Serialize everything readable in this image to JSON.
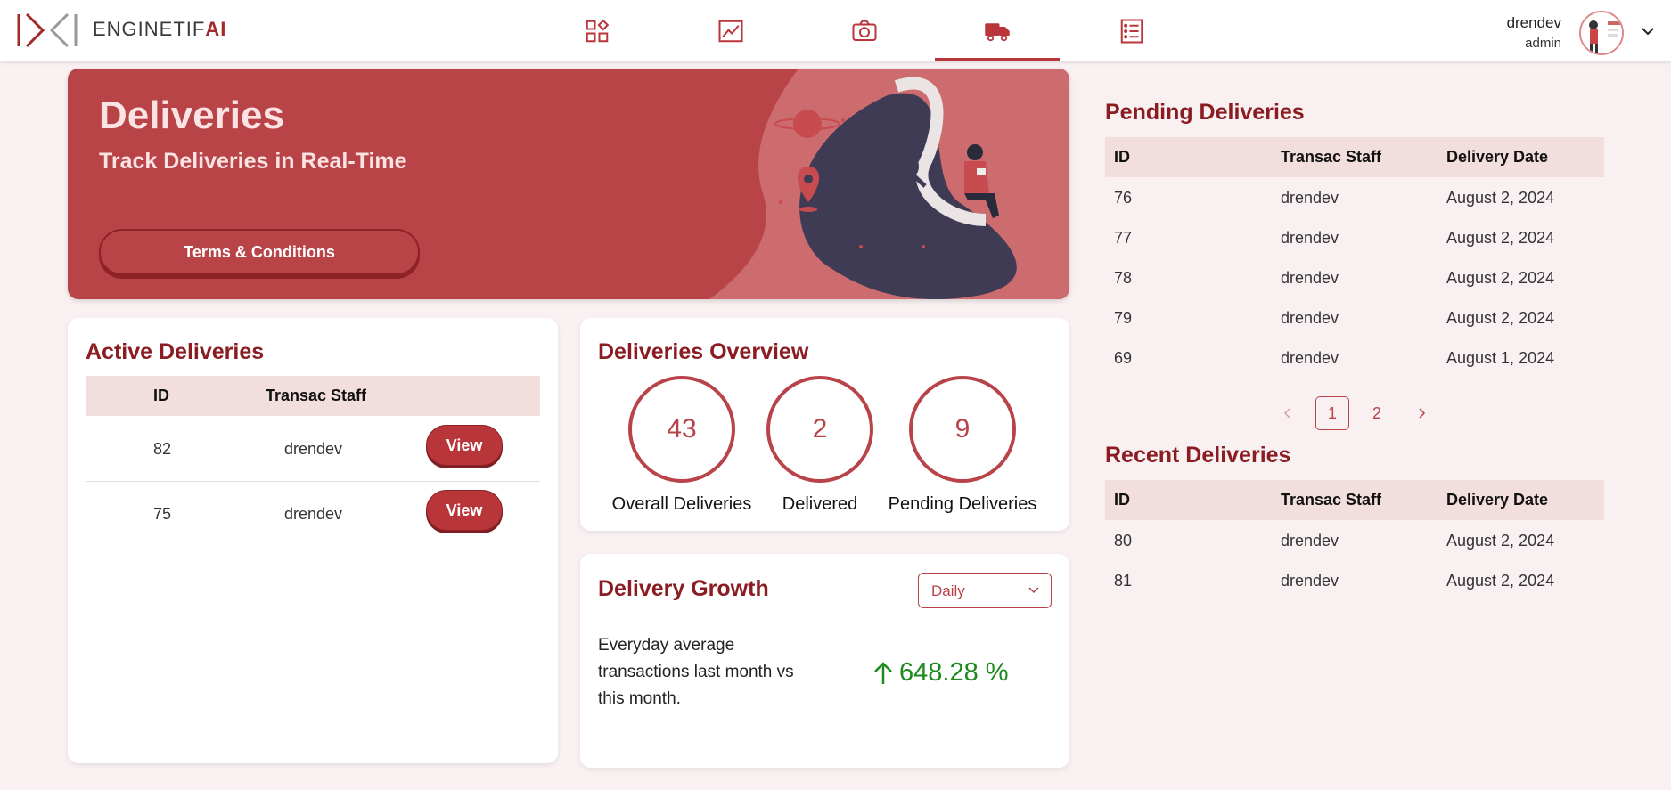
{
  "brand": {
    "name_prefix": "ENGINETIF",
    "name_suffix": "AI"
  },
  "nav": [
    {
      "icon": "dashboard-grid-icon"
    },
    {
      "icon": "chart-line-icon"
    },
    {
      "icon": "camera-icon"
    },
    {
      "icon": "truck-icon",
      "active": true
    },
    {
      "icon": "list-document-icon"
    }
  ],
  "user": {
    "name": "drendev",
    "role": "admin"
  },
  "hero": {
    "title": "Deliveries",
    "subtitle": "Track Deliveries in Real-Time",
    "terms_label": "Terms & Conditions"
  },
  "active_deliveries": {
    "title": "Active Deliveries",
    "headers": [
      "ID",
      "Transac Staff"
    ],
    "rows": [
      {
        "id": "82",
        "staff": "drendev",
        "action": "View"
      },
      {
        "id": "75",
        "staff": "drendev",
        "action": "View"
      }
    ]
  },
  "overview": {
    "title": "Deliveries Overview",
    "stats": [
      {
        "value": "43",
        "label": "Overall Deliveries"
      },
      {
        "value": "2",
        "label": "Delivered"
      },
      {
        "value": "9",
        "label": "Pending Deliveries"
      }
    ]
  },
  "growth": {
    "title": "Delivery Growth",
    "period": "Daily",
    "description": "Everyday average transactions last month vs this month.",
    "value": "648.28 %",
    "trend_color": "#1d8a1d"
  },
  "pending": {
    "title": "Pending Deliveries",
    "headers": [
      "ID",
      "Transac Staff",
      "Delivery Date"
    ],
    "rows": [
      {
        "id": "76",
        "staff": "drendev",
        "date": "August 2, 2024"
      },
      {
        "id": "77",
        "staff": "drendev",
        "date": "August 2, 2024"
      },
      {
        "id": "78",
        "staff": "drendev",
        "date": "August 2, 2024"
      },
      {
        "id": "79",
        "staff": "drendev",
        "date": "August 2, 2024"
      },
      {
        "id": "69",
        "staff": "drendev",
        "date": "August 1, 2024"
      }
    ],
    "pagination": {
      "pages": [
        "1",
        "2"
      ],
      "current": "1"
    }
  },
  "recent": {
    "title": "Recent Deliveries",
    "headers": [
      "ID",
      "Transac Staff",
      "Delivery Date"
    ],
    "rows": [
      {
        "id": "80",
        "staff": "drendev",
        "date": "August 2, 2024"
      },
      {
        "id": "81",
        "staff": "drendev",
        "date": "August 2, 2024"
      }
    ]
  },
  "colors": {
    "accent": "#b8363a",
    "title": "#8a1c22",
    "hero_bg": "#b94448",
    "page_bg": "#f9f1f1"
  }
}
